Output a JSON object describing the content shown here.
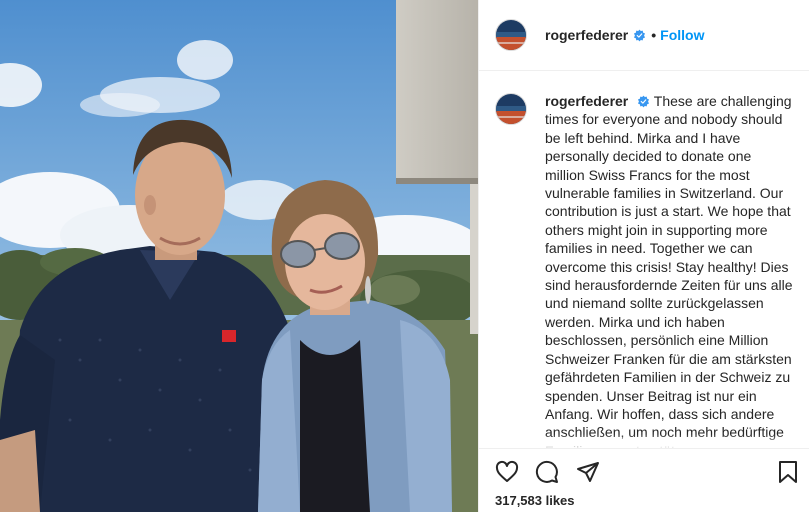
{
  "post": {
    "username": "roger­federer",
    "follow_label": "Follow",
    "separator": "•",
    "verified_icon": "verified-badge-icon",
    "photo_alt_icon": "post-photo"
  },
  "caption": {
    "username": "rogerfederer",
    "text": "These are challenging times for everyone and nobody should be left behind. Mirka and I have personally decided to donate one million Swiss Francs for the most vulnerable families in Switzerland. Our contribution is just a start. We hope that others might join in supporting more families in need. Together we can overcome this crisis! Stay healthy! Dies sind herausfordernde Zeiten für uns alle und niemand sollte zurückgelassen werden. Mirka und ich haben beschlossen, persönlich eine Million Schweizer Franken für die am stärksten gefährdeten Familien in der Schweiz zu spenden. Unser Beitrag ist nur ein Anfang. Wir hoffen, dass sich andere anschließen, um noch mehr bedürftige Familien zu unterstützen."
  },
  "actions": {
    "like_icon": "heart-icon",
    "comment_icon": "comment-icon",
    "share_icon": "share-icon",
    "save_icon": "bookmark-icon",
    "likes_text": "317,583 likes"
  },
  "colors": {
    "link_blue": "#0095f6",
    "verified_blue": "#3897f0",
    "text": "#262626",
    "divider": "#efefef"
  }
}
